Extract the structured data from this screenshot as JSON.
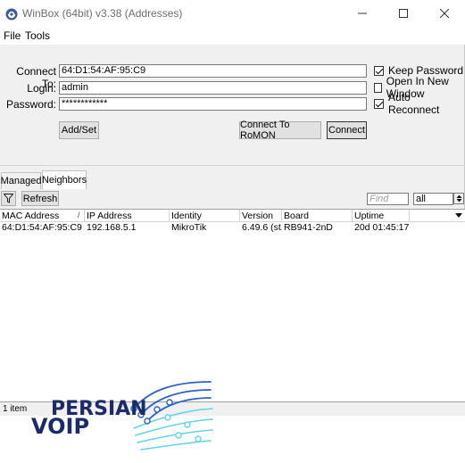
{
  "window": {
    "title": "WinBox (64bit) v3.38 (Addresses)"
  },
  "menu": [
    {
      "label": "File"
    },
    {
      "label": "Tools"
    }
  ],
  "form": {
    "connect_to_label": "Connect To:",
    "connect_to_value": "64:D1:54:AF:95:C9",
    "login_label": "Login:",
    "login_value": "admin",
    "password_label": "Password:",
    "password_value": "************",
    "keep_password_label": "Keep Password",
    "keep_password_checked": true,
    "open_new_window_label": "Open In New Window",
    "open_new_window_checked": false,
    "auto_reconnect_label": "Auto Reconnect",
    "auto_reconnect_checked": true
  },
  "buttons": {
    "add_set": "Add/Set",
    "connect_romon": "Connect To RoMON",
    "connect": "Connect"
  },
  "tabs": [
    {
      "label": "Managed",
      "active": false
    },
    {
      "label": "Neighbors",
      "active": true
    }
  ],
  "toolbar": {
    "refresh_label": "Refresh",
    "find_placeholder": "Find",
    "filter_value": "all"
  },
  "table": {
    "columns": [
      "MAC Address",
      "IP Address",
      "Identity",
      "Version",
      "Board",
      "Uptime"
    ],
    "rows": [
      {
        "mac": "64:D1:54:AF:95:C9",
        "ip": "192.168.5.1",
        "identity": "MikroTik",
        "version": "6.49.6 (st...",
        "board": "RB941-2nD",
        "uptime": "20d 01:45:17"
      }
    ]
  },
  "status": {
    "item_count": "1 item"
  },
  "watermark": {
    "line1": "PERSIAN",
    "line2": "VOIP"
  },
  "colors": {
    "window_bg": "#f0f0f0",
    "logo_navy": "#1b2a6b",
    "logo_blue": "#2a63c9",
    "logo_cyan": "#5fd6e8"
  }
}
